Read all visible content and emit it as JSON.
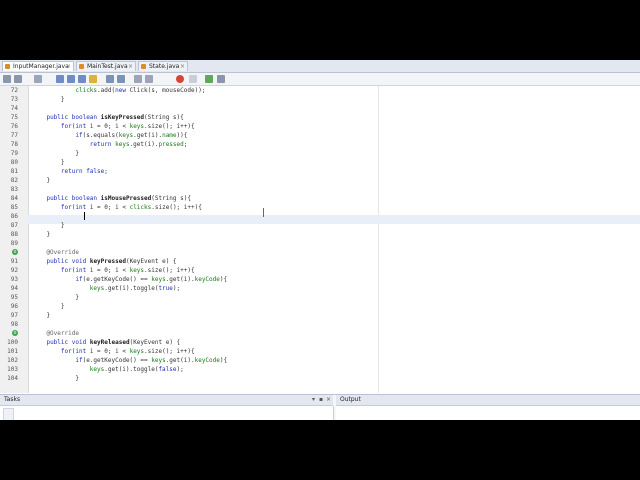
{
  "editor_tabs": [
    {
      "label": "InputManager.java",
      "active": true
    },
    {
      "label": "MainTest.java",
      "active": false
    },
    {
      "label": "State.java",
      "active": false
    }
  ],
  "toolbar_icons": [
    "back-icon",
    "forward-icon",
    "history-icon",
    "search-icon",
    "find-previous-icon",
    "find-next-icon",
    "toggle-highlight-icon",
    "shift-left-icon",
    "shift-right-icon",
    "comment-icon",
    "uncomment-icon",
    "record-macro-icon",
    "stop-macro-icon",
    "run-icon",
    "save-icon"
  ],
  "code_lines": [
    {
      "num": "72",
      "text": "            clicks.add(new Click(s, mouseCode));"
    },
    {
      "num": "73",
      "text": "        }"
    },
    {
      "num": "74",
      "text": ""
    },
    {
      "num": "75",
      "text": "    public boolean isKeyPressed(String s){"
    },
    {
      "num": "76",
      "text": "        for(int i = 0; i < keys.size(); i++){"
    },
    {
      "num": "77",
      "text": "            if(s.equals(keys.get(i).name)){"
    },
    {
      "num": "78",
      "text": "                return keys.get(i).pressed;"
    },
    {
      "num": "79",
      "text": "            }"
    },
    {
      "num": "80",
      "text": "        }"
    },
    {
      "num": "81",
      "text": "        return false;"
    },
    {
      "num": "82",
      "text": "    }"
    },
    {
      "num": "83",
      "text": ""
    },
    {
      "num": "84",
      "text": "    public boolean isMousePressed(String s){"
    },
    {
      "num": "85",
      "text": "        for(int i = 0; i < clicks.size(); i++){"
    },
    {
      "num": "86",
      "text": "            "
    },
    {
      "num": "87",
      "text": "        }"
    },
    {
      "num": "88",
      "text": "    }"
    },
    {
      "num": "89",
      "text": ""
    },
    {
      "num": "90",
      "text": "    @Override"
    },
    {
      "num": "91",
      "text": "    public void keyPressed(KeyEvent e) {"
    },
    {
      "num": "92",
      "text": "        for(int i = 0; i < keys.size(); i++){"
    },
    {
      "num": "93",
      "text": "            if(e.getKeyCode() == keys.get(i).keyCode){"
    },
    {
      "num": "94",
      "text": "                keys.get(i).toggle(true);"
    },
    {
      "num": "95",
      "text": "            }"
    },
    {
      "num": "96",
      "text": "        }"
    },
    {
      "num": "97",
      "text": "    }"
    },
    {
      "num": "98",
      "text": ""
    },
    {
      "num": "99",
      "text": "    @Override"
    },
    {
      "num": "100",
      "text": "    public void keyReleased(KeyEvent e) {"
    },
    {
      "num": "101",
      "text": "        for(int i = 0; i < keys.size(); i++){"
    },
    {
      "num": "102",
      "text": "            if(e.getKeyCode() == keys.get(i).keyCode){"
    },
    {
      "num": "103",
      "text": "                keys.get(i).toggle(false);"
    },
    {
      "num": "104",
      "text": "            }"
    }
  ],
  "override_marker_lines": [
    "90",
    "99"
  ],
  "current_line": "86",
  "bottom_panels": {
    "tasks_title": "Tasks",
    "output_title": "Output"
  },
  "colors": {
    "keyword": "#1f2fb8",
    "field": "#1a7a1a",
    "current_line": "#e9eff8"
  }
}
